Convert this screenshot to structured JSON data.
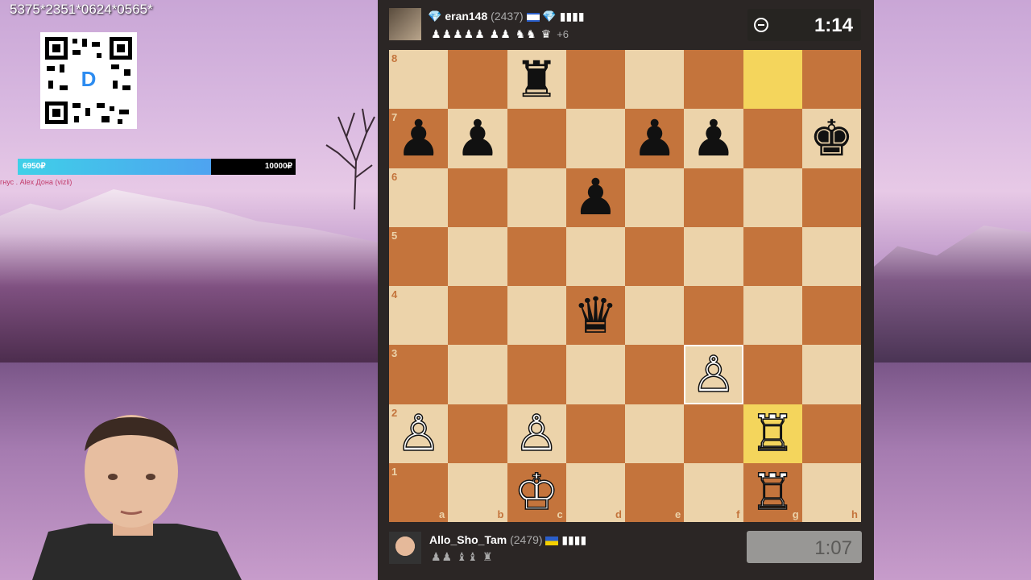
{
  "overlay": {
    "code": "5375*2351*0624*0565*",
    "qr_letter": "D",
    "progress_left": "6950₽",
    "progress_right": "10000₽",
    "progress_fraction": 0.695,
    "donors": "гнус . Alex Дона (vizli)"
  },
  "top_player": {
    "name": "eran148",
    "rating": "(2437)",
    "captured": "♟♟♟♟♟ ♟♟ ♞♞ ♛",
    "advantage": "+6",
    "badges": "▮▮▮▮",
    "clock": "1:14"
  },
  "bottom_player": {
    "name": "Allo_Sho_Tam",
    "rating": "(2479)",
    "captured": "♟♟ ♝♝ ♜",
    "badges": "▮▮▮▮",
    "clock": "1:07"
  },
  "board": {
    "ranks": [
      "8",
      "7",
      "6",
      "5",
      "4",
      "3",
      "2",
      "1"
    ],
    "files": [
      "a",
      "b",
      "c",
      "d",
      "e",
      "f",
      "g",
      "h"
    ],
    "pieces": {
      "c8": {
        "glyph": "♜",
        "color": "black"
      },
      "a7": {
        "glyph": "♟",
        "color": "black"
      },
      "b7": {
        "glyph": "♟",
        "color": "black"
      },
      "e7": {
        "glyph": "♟",
        "color": "black"
      },
      "f7": {
        "glyph": "♟",
        "color": "black"
      },
      "h7": {
        "glyph": "♚",
        "color": "black"
      },
      "d6": {
        "glyph": "♟",
        "color": "black"
      },
      "d4": {
        "glyph": "♛",
        "color": "black"
      },
      "f3": {
        "glyph": "♙",
        "color": "white"
      },
      "a2": {
        "glyph": "♙",
        "color": "white"
      },
      "c2": {
        "glyph": "♙",
        "color": "white"
      },
      "g2": {
        "glyph": "♖",
        "color": "white"
      },
      "c1": {
        "glyph": "♔",
        "color": "white"
      },
      "g1": {
        "glyph": "♖",
        "color": "white"
      }
    },
    "highlight": [
      "g8",
      "g2"
    ],
    "selected": "f3"
  },
  "colors": {
    "light_square": "#ecd3aa",
    "dark_square": "#c4743c",
    "highlight": "#f4d55c",
    "panel_bg": "#2b2625"
  }
}
